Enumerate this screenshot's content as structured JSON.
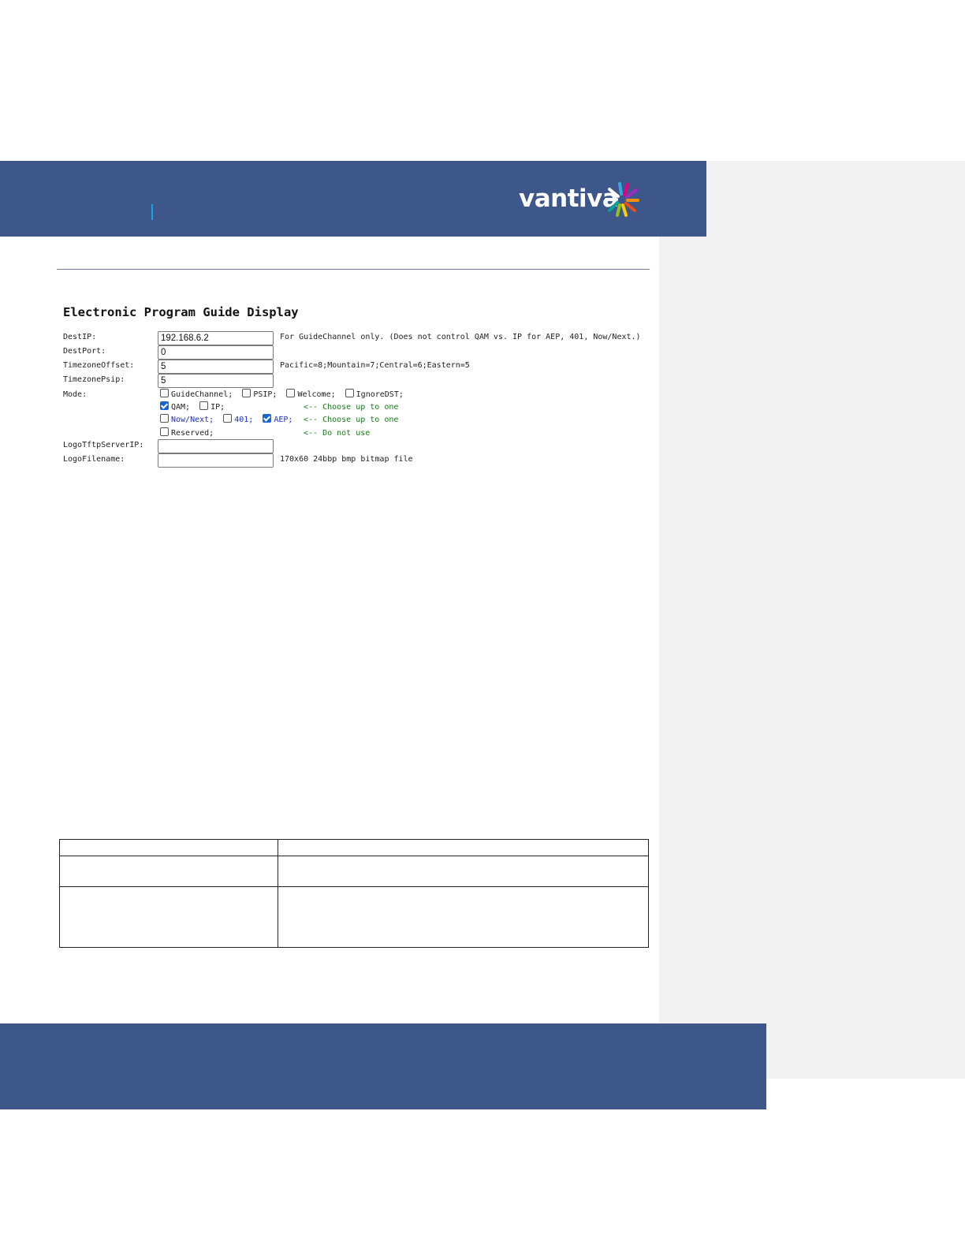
{
  "brand": {
    "logo_text": "vantiva",
    "header_color": "#3e578a",
    "accent_color": "#19a6e0"
  },
  "epg": {
    "title": "Electronic Program Guide Display",
    "fields": [
      {
        "label": "DestIP:",
        "value": "192.168.6.2",
        "hint": "For GuideChannel only. (Does not control QAM vs. IP for AEP, 401, Now/Next.)"
      },
      {
        "label": "DestPort:",
        "value": "0",
        "hint": ""
      },
      {
        "label": "TimezoneOffset:",
        "value": "5",
        "hint": "Pacific=8;Mountain=7;Central=6;Eastern=5"
      },
      {
        "label": "TimezonePsip:",
        "value": "5",
        "hint": ""
      }
    ],
    "mode": {
      "label": "Mode:",
      "rows": [
        {
          "options": [
            {
              "label": "GuideChannel;",
              "checked": false
            },
            {
              "label": "PSIP;",
              "checked": false
            },
            {
              "label": "Welcome;",
              "checked": false
            },
            {
              "label": "IgnoreDST;",
              "checked": false
            }
          ],
          "note": ""
        },
        {
          "options": [
            {
              "label": "QAM;",
              "checked": true
            },
            {
              "label": "IP;",
              "checked": false
            }
          ],
          "note": "<-- Choose up to one"
        },
        {
          "options": [
            {
              "label": "Now/Next;",
              "checked": false
            },
            {
              "label": "401;",
              "checked": false
            },
            {
              "label": "AEP;",
              "checked": true
            }
          ],
          "note": "<-- Choose up to one"
        },
        {
          "options": [
            {
              "label": "Reserved;",
              "checked": false
            }
          ],
          "note": "<-- Do not use"
        }
      ]
    },
    "logo_fields": [
      {
        "label": "LogoTftpServerIP:",
        "value": "",
        "hint": ""
      },
      {
        "label": "LogoFilename:",
        "value": "",
        "hint": "170x60 24bbp bmp bitmap file"
      }
    ]
  }
}
